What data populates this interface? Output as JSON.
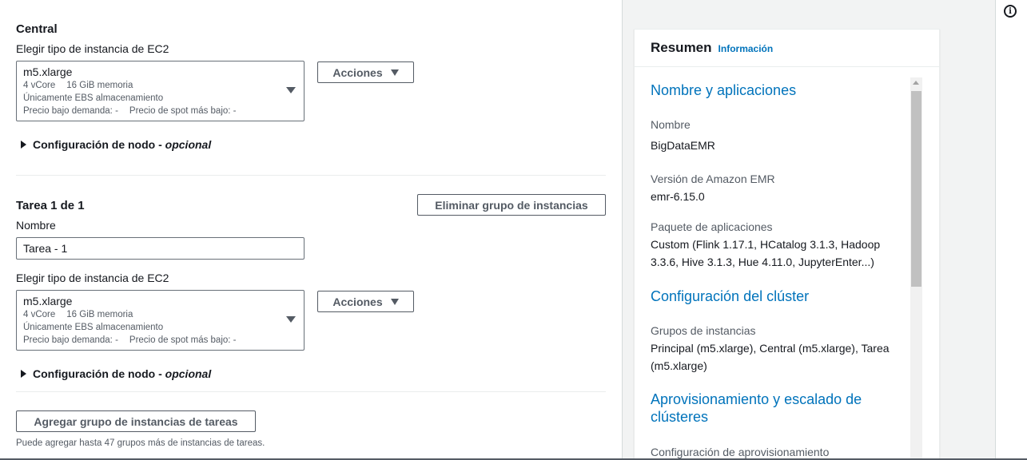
{
  "central": {
    "heading": "Central",
    "ec2_label": "Elegir tipo de instancia de EC2",
    "instance": {
      "type": "m5.xlarge",
      "vcore": "4 vCore",
      "memory": "16 GiB memoria",
      "storage": "Únicamente EBS almacenamiento",
      "ondemand": "Precio bajo demanda: -",
      "spot": "Precio de spot más bajo: -"
    },
    "actions_label": "Acciones",
    "node_config": "Configuración de nodo",
    "node_config_optional": "opcional"
  },
  "task": {
    "heading": "Tarea 1 de 1",
    "remove_label": "Eliminar grupo de instancias",
    "name_label": "Nombre",
    "name_value": "Tarea - 1",
    "ec2_label": "Elegir tipo de instancia de EC2",
    "instance": {
      "type": "m5.xlarge",
      "vcore": "4 vCore",
      "memory": "16 GiB memoria",
      "storage": "Únicamente EBS almacenamiento",
      "ondemand": "Precio bajo demanda: -",
      "spot": "Precio de spot más bajo: -"
    },
    "actions_label": "Acciones",
    "node_config": "Configuración de nodo",
    "node_config_optional": "opcional"
  },
  "add_task": {
    "label": "Agregar grupo de instancias de tareas",
    "hint": "Puede agregar hasta 47 grupos más de instancias de tareas."
  },
  "summary": {
    "title": "Resumen",
    "info_link": "Información",
    "sections": {
      "names_apps": "Nombre y aplicaciones",
      "name_key": "Nombre",
      "name_value": "BigDataEMR",
      "version_key": "Versión de Amazon EMR",
      "version_value": "emr-6.15.0",
      "bundle_key": "Paquete de aplicaciones",
      "bundle_value": "Custom (Flink 1.17.1, HCatalog 3.1.3, Hadoop 3.3.6, Hive 3.1.3, Hue 4.11.0, JupyterEnter...)",
      "cluster_config": "Configuración del clúster",
      "groups_key": "Grupos de instancias",
      "groups_value": "Principal (m5.xlarge), Central (m5.xlarge), Tarea (m5.xlarge)",
      "provisioning": "Aprovisionamiento y escalado de clústeres",
      "provisioning_key": "Configuración de aprovisionamiento"
    }
  },
  "icons": {
    "info": "i"
  }
}
